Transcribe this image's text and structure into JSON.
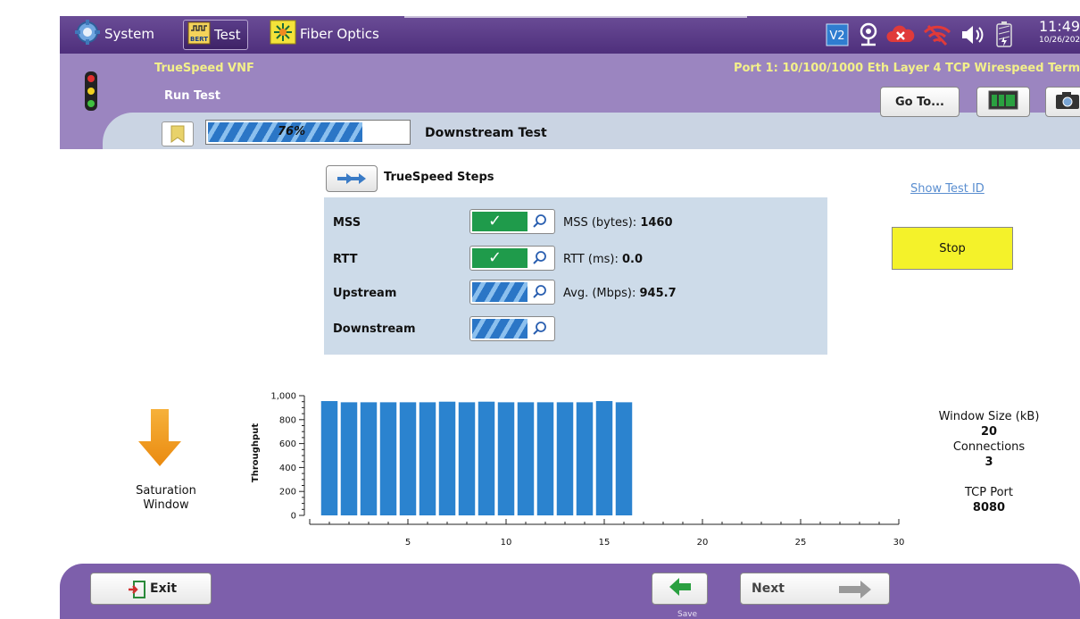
{
  "topbar": {
    "tabs": [
      {
        "label": "System",
        "icon": "gear-icon"
      },
      {
        "label": "Test",
        "icon": "bert-icon",
        "icon_text": "BERT"
      },
      {
        "label": "Fiber Optics",
        "icon": "fiber-icon"
      }
    ],
    "status_icons": [
      "v2-icon",
      "gps-icon",
      "cloud-icon",
      "wifi-icon",
      "speaker-icon",
      "battery-icon"
    ],
    "status_text": {
      "v2": "V2"
    },
    "time": "11:49",
    "date": "10/26/202"
  },
  "header": {
    "subtitle": "TrueSpeed VNF",
    "port": "Port 1: 10/100/1000 Eth Layer 4 TCP Wirespeed Term",
    "section": "Run Test",
    "goto_label": "Go To...",
    "progress_percent": 76,
    "progress_text": "76%",
    "stage": "Downstream Test"
  },
  "steps": {
    "title": "TrueSpeed Steps",
    "items": [
      {
        "label": "MSS",
        "status": "done",
        "result_label": "MSS (bytes):",
        "result_value": "1460"
      },
      {
        "label": "RTT",
        "status": "done",
        "result_label": "RTT (ms):",
        "result_value": "0.0"
      },
      {
        "label": "Upstream",
        "status": "running",
        "result_label": "Avg. (Mbps):",
        "result_value": "945.7"
      },
      {
        "label": "Downstream",
        "status": "running",
        "result_label": "",
        "result_value": ""
      }
    ]
  },
  "right_panel": {
    "show_test_id": "Show Test ID",
    "stop_label": "Stop",
    "window_size_label": "Window Size (kB)",
    "window_size_value": "20",
    "connections_label": "Connections",
    "connections_value": "3",
    "tcp_port_label": "TCP Port",
    "tcp_port_value": "8080"
  },
  "saturation": {
    "line1": "Saturation",
    "line2": "Window"
  },
  "chart_data": {
    "type": "bar",
    "ylabel": "Throughput",
    "xlabel": "",
    "xlim": [
      0,
      30
    ],
    "ylim": [
      0,
      1000
    ],
    "x_ticks": [
      5,
      10,
      15,
      20,
      25,
      30
    ],
    "y_ticks": [
      0,
      200,
      400,
      600,
      800,
      1000
    ],
    "y_tick_labels": [
      "0",
      "200",
      "400",
      "600",
      "800",
      "1,000"
    ],
    "x": [
      1,
      2,
      3,
      4,
      5,
      6,
      7,
      8,
      9,
      10,
      11,
      12,
      13,
      14,
      15,
      16
    ],
    "values": [
      955,
      945,
      945,
      945,
      945,
      945,
      950,
      945,
      950,
      945,
      945,
      945,
      945,
      945,
      955,
      945
    ],
    "bar_color": "#2b83cf"
  },
  "footer": {
    "exit_label": "Exit",
    "save_label": "Save",
    "next_label": "Next"
  },
  "colors": {
    "purple_dark": "#4e2f7c",
    "purple_header": "#9b85c0",
    "accent_yellow": "#f3f08a",
    "stop_yellow": "#f4f22a",
    "done_green": "#1f9b4b",
    "bar_blue": "#2b83cf"
  }
}
